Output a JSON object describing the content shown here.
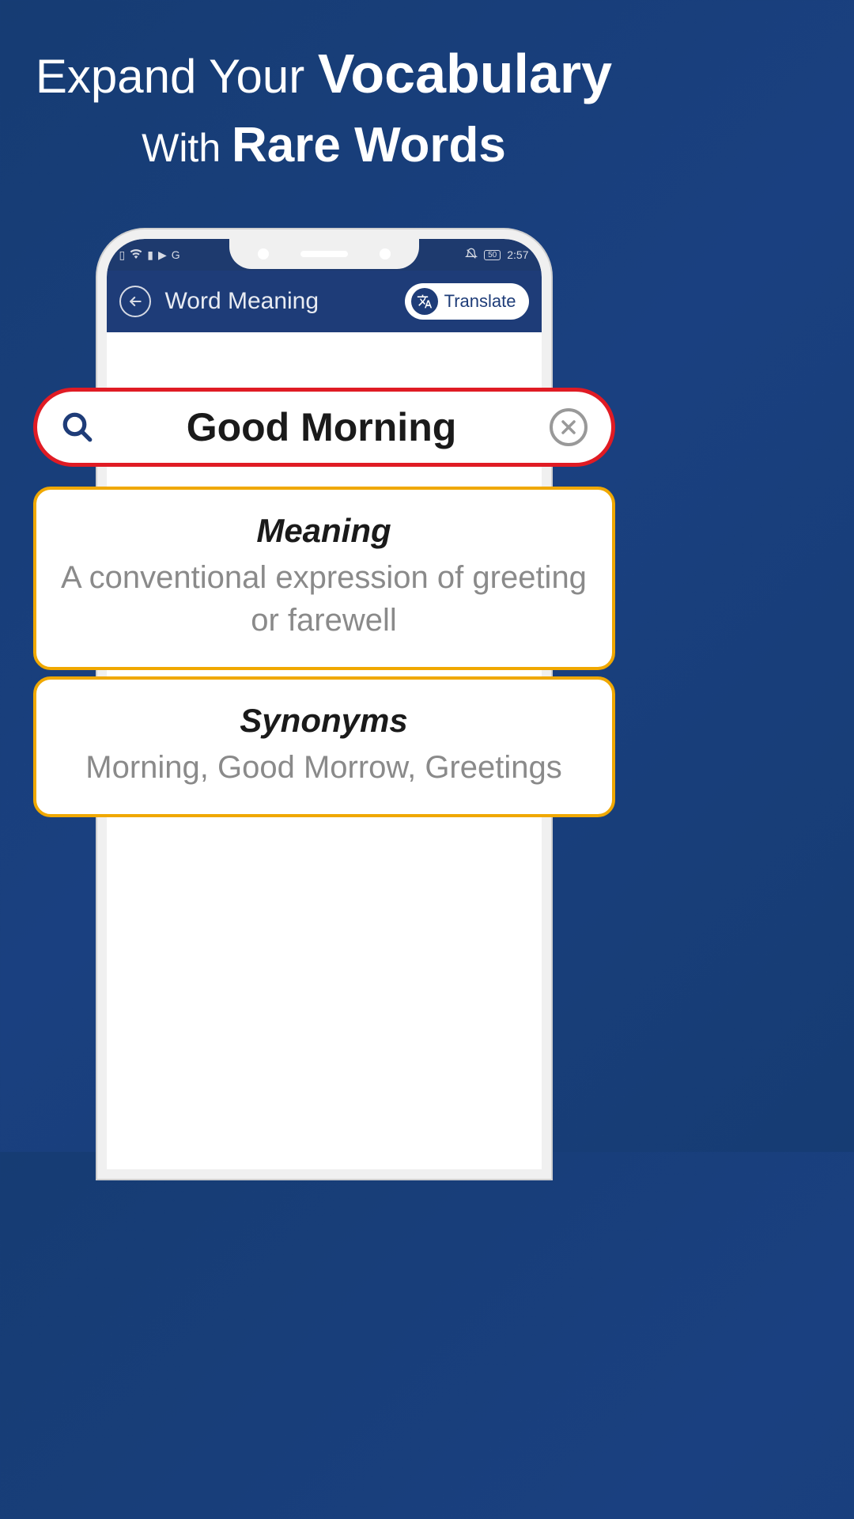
{
  "headline": {
    "part1": "Expand Your",
    "bold1": "Vocabulary",
    "part2": "With",
    "bold2": "Rare Words"
  },
  "status": {
    "battery": "50",
    "time": "2:57"
  },
  "appbar": {
    "title": "Word Meaning",
    "translate_label": "Translate"
  },
  "search": {
    "query": "Good Morning"
  },
  "meaning": {
    "title": "Meaning",
    "text": "A conventional expression of greeting or farewell"
  },
  "synonyms": {
    "title": "Synonyms",
    "text": "Morning, Good Morrow, Greetings"
  }
}
